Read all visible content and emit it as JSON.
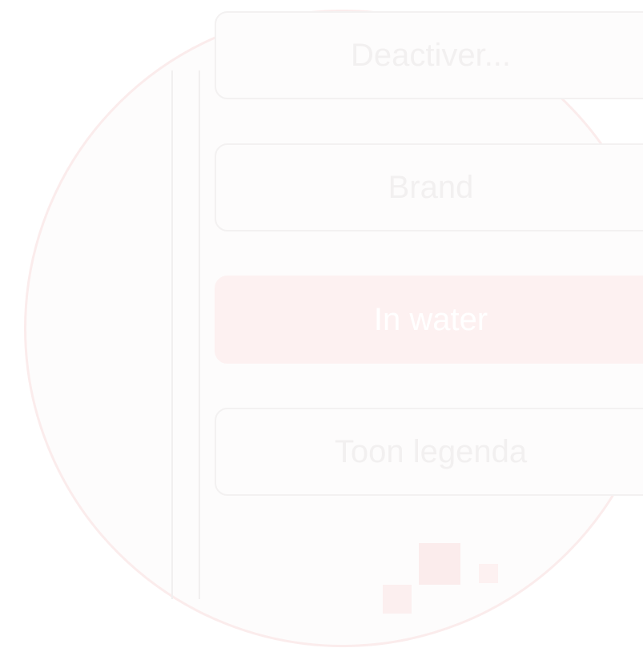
{
  "menu": {
    "items": [
      {
        "label": "Deactiver..."
      },
      {
        "label": "Brand"
      },
      {
        "label": "In water"
      },
      {
        "label": "Toon legenda"
      }
    ]
  },
  "colors": {
    "accent": "#fdf1f1",
    "border": "#f3f1f1",
    "text": "#f2f0f0"
  }
}
